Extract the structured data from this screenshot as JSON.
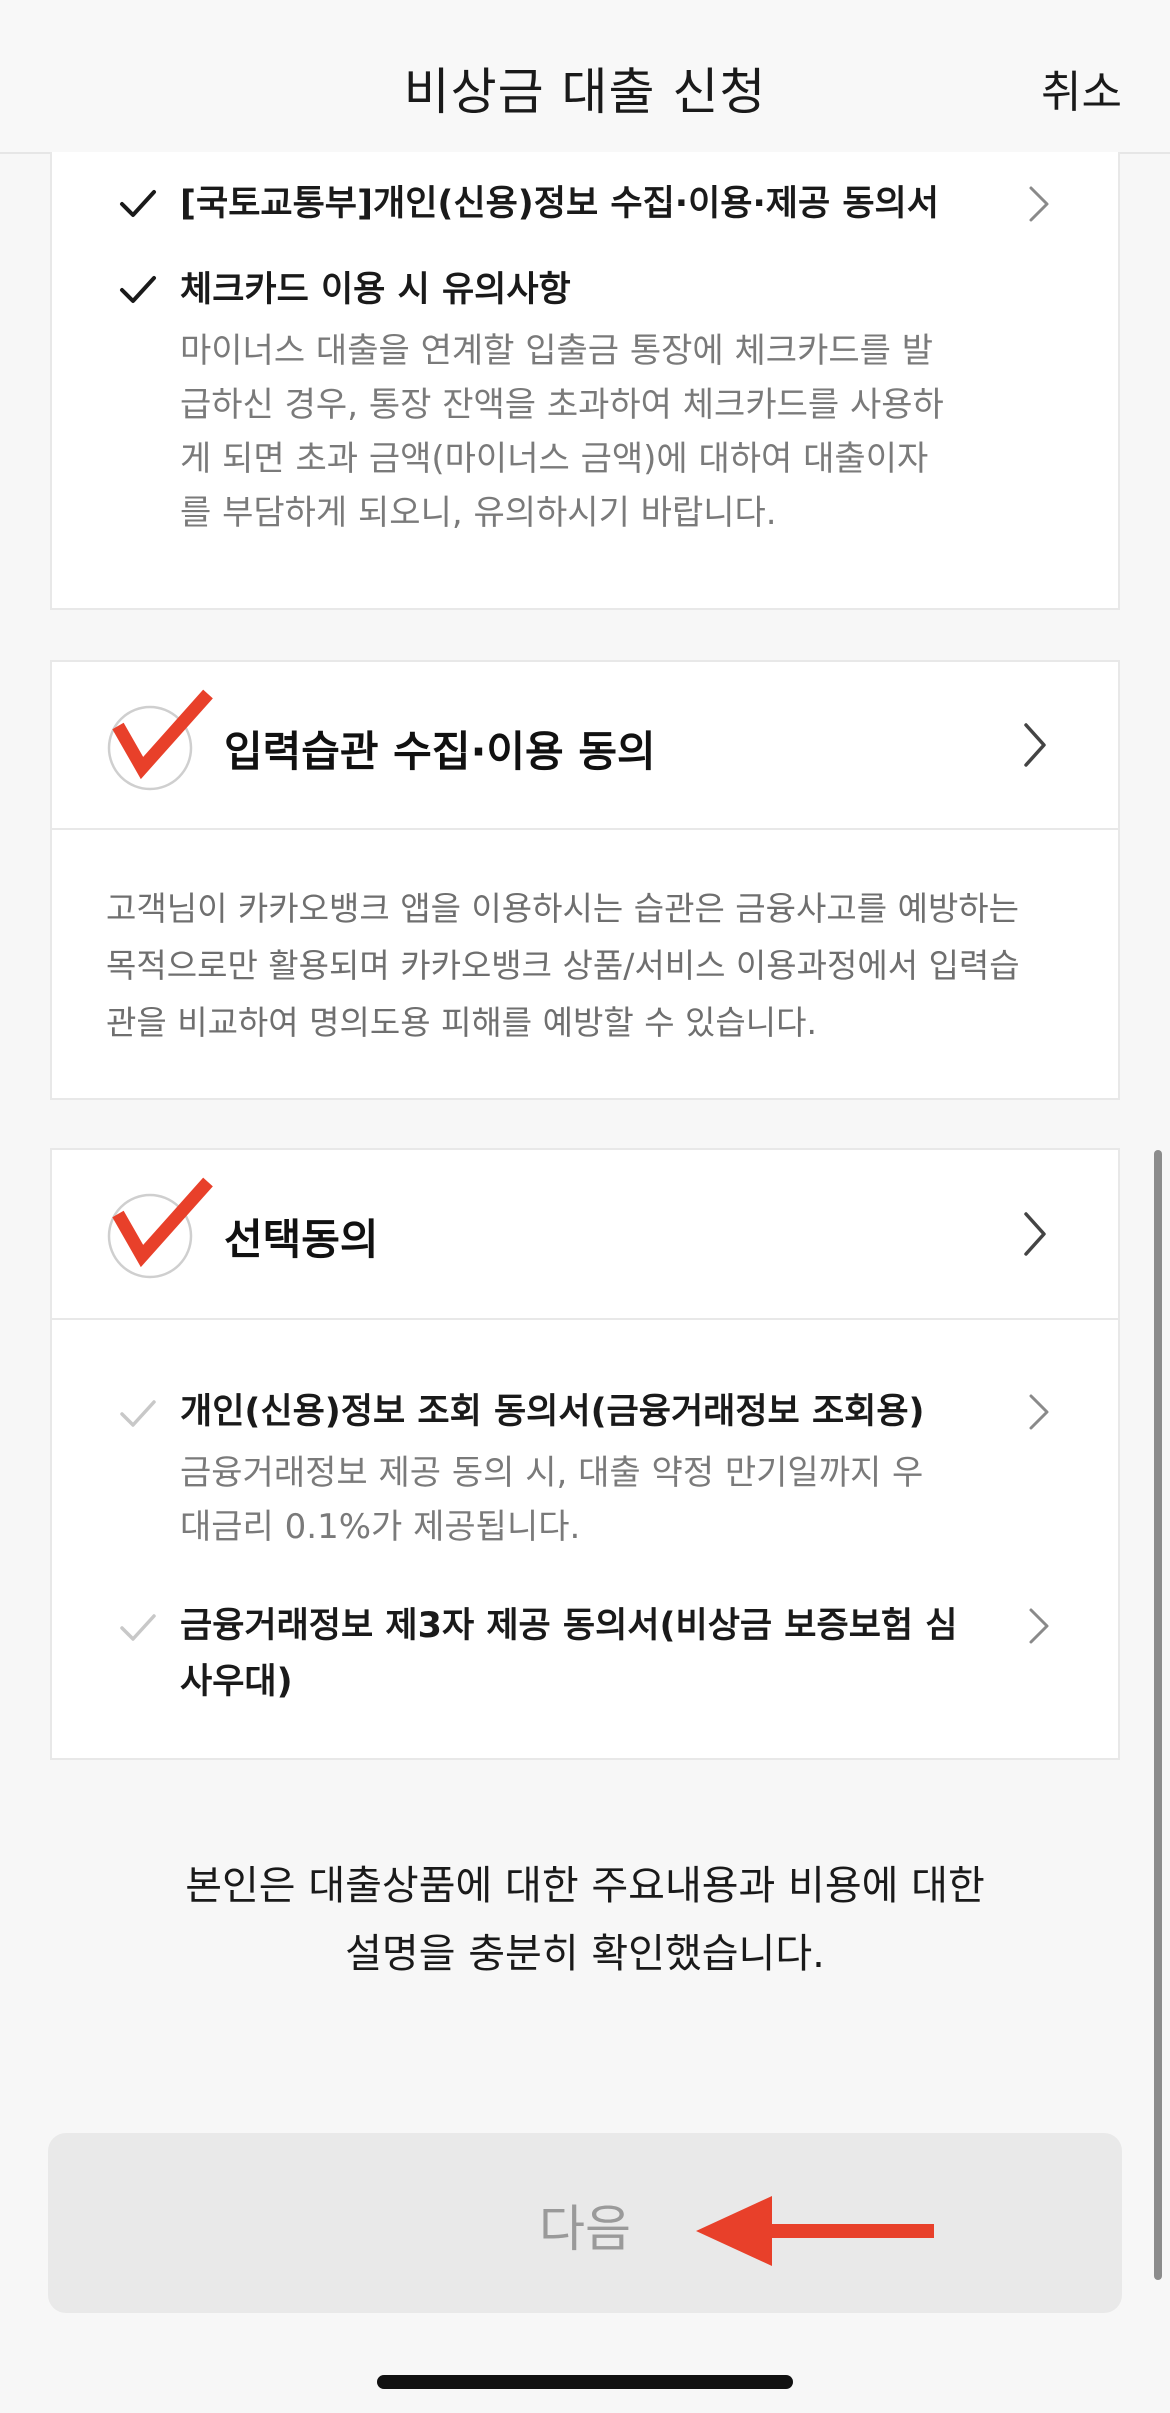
{
  "nav": {
    "title": "비상금 대출 신청",
    "cancel_label": "취소"
  },
  "required_items": [
    {
      "title": "[국토교통부]개인(신용)정보 수집·이용·제공 동의서",
      "checked": true
    },
    {
      "title": "체크카드 이용 시 유의사항",
      "checked": true,
      "description_lines": [
        "마이너스 대출을 연계할 입출금 통장에 체크카드를 발",
        "급하신 경우, 통장 잔액을 초과하여 체크카드를 사용하",
        "게 되면 초과 금액(마이너스 금액)에 대하여 대출이자",
        "를 부담하게 되오니, 유의하시기 바랍니다."
      ]
    }
  ],
  "input_habit_section": {
    "title": "입력습관 수집·이용 동의",
    "checked": true,
    "description_lines": [
      "고객님이 카카오뱅크 앱을 이용하시는 습관은 금융사고를 예방하는",
      "목적으로만 활용되며 카카오뱅크 상품/서비스 이용과정에서 입력습",
      "관을 비교하여 명의도용 피해를 예방할 수 있습니다."
    ]
  },
  "optional_section": {
    "title": "선택동의",
    "checked": true,
    "items": [
      {
        "title": "개인(신용)정보 조회 동의서(금융거래정보 조회용)",
        "checked": false,
        "description_lines": [
          "금융거래정보 제공 동의 시, 대출 약정 만기일까지 우",
          "대금리 0.1%가 제공됩니다."
        ]
      },
      {
        "title_lines": [
          "금융거래정보 제3자 제공 동의서(비상금 보증보험 심",
          "사우대)"
        ],
        "checked": false
      }
    ]
  },
  "confirmation": {
    "lines": [
      "본인은 대출상품에 대한 주요내용과 비용에 대한",
      "설명을 충분히 확인했습니다."
    ]
  },
  "next_button": {
    "label": "다음",
    "enabled": false
  },
  "colors": {
    "accent_red": "#e8402a",
    "check_dark": "#1a1a1a",
    "check_light": "#c8c8c8",
    "disabled_button": "#e9e9e9"
  }
}
